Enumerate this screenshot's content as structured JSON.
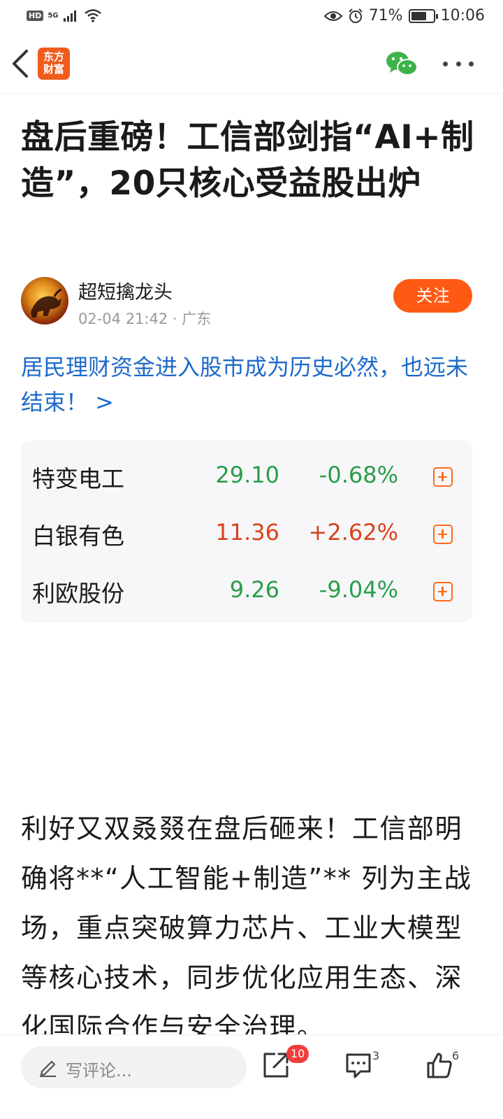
{
  "status_bar": {
    "hd": "HD",
    "network": "5G",
    "battery_level": 0.71,
    "battery_text": "71%",
    "time": "10:06"
  },
  "nav": {
    "logo_line1": "东方",
    "logo_line2": "财富"
  },
  "article": {
    "title": "盘后重磅！工信部剑指“AI+制造”，20只核心受益股出炉",
    "author": "超短擒龙头",
    "date": "02-04 21:42",
    "location": "· 广东",
    "follow_label": "关注",
    "promo_link": "居民理财资金进入股市成为历史必然，也远未结束！ >",
    "body": "利好又双叒叕在盘后砸来！工信部明确将**“人工智能+制造”** 列为主战场，重点突破算力芯片、工业大模型等核心技术，同步优化应用生态、深化国际合作与安全治理。"
  },
  "stocks": [
    {
      "name": "特变电工",
      "price": "29.10",
      "change": "-0.68%",
      "trend": "down"
    },
    {
      "name": "白银有色",
      "price": "11.36",
      "change": "+2.62%",
      "trend": "up"
    },
    {
      "name": "利欧股份",
      "price": "9.26",
      "change": "-9.04%",
      "trend": "down"
    }
  ],
  "bottom_bar": {
    "comment_placeholder": "写评论...",
    "share_badge": "10",
    "comment_count": "3",
    "like_count": "6"
  },
  "colors": {
    "up": "#d8431a",
    "down": "#2a9d4a",
    "accent": "#ff5a14",
    "link": "#1e6ac9"
  }
}
